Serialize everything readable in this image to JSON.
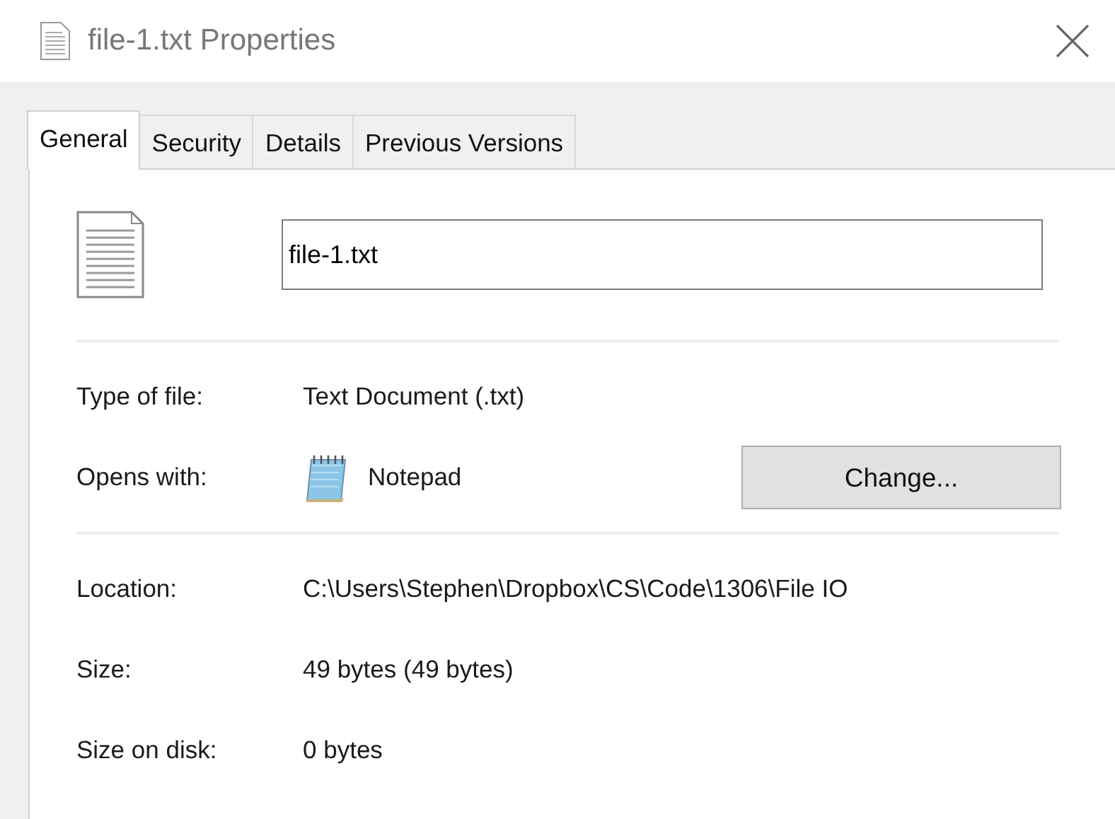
{
  "window": {
    "title": "file-1.txt Properties"
  },
  "tabs": [
    {
      "label": "General",
      "selected": true
    },
    {
      "label": "Security",
      "selected": false
    },
    {
      "label": "Details",
      "selected": false
    },
    {
      "label": "Previous Versions",
      "selected": false
    }
  ],
  "file_name": {
    "value": "file-1.txt"
  },
  "sections": [
    {
      "rows": [
        {
          "kind": "text",
          "label": "Type of file:",
          "value": "Text Document (.txt)"
        },
        {
          "kind": "app",
          "label": "Opens with:",
          "value": "Notepad",
          "button": "Change..."
        }
      ]
    },
    {
      "rows": [
        {
          "kind": "text",
          "label": "Location:",
          "value": "C:\\Users\\Stephen\\Dropbox\\CS\\Code\\1306\\File IO"
        },
        {
          "kind": "text",
          "label": "Size:",
          "value": "49 bytes (49 bytes)"
        },
        {
          "kind": "text",
          "label": "Size on disk:",
          "value": "0 bytes"
        }
      ]
    }
  ]
}
